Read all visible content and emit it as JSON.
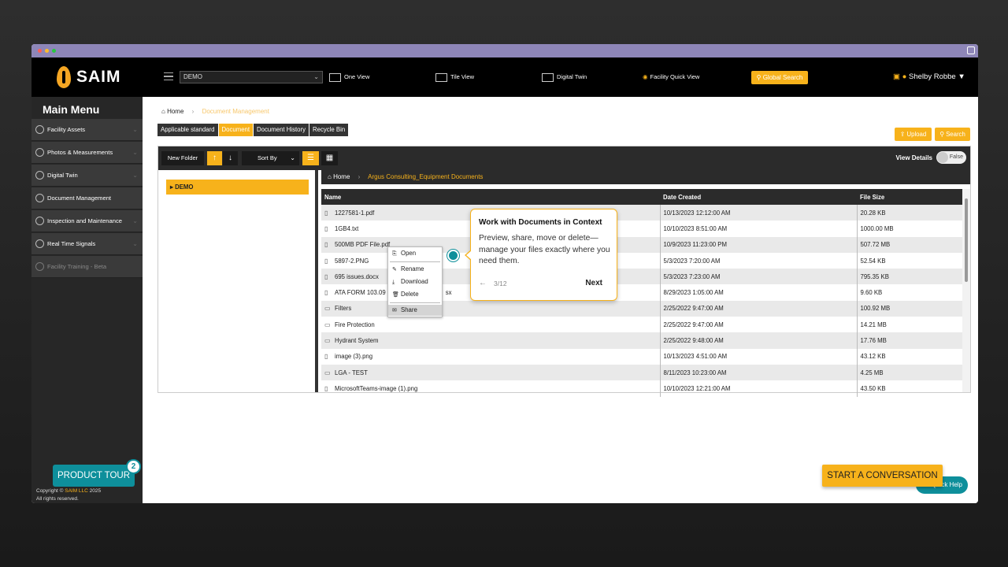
{
  "window": {
    "dot_colors": [
      "#ff5f57",
      "#febc2e",
      "#28c840"
    ]
  },
  "topbar": {
    "logo_text": "SAIM",
    "site_select": "DEMO",
    "nav": {
      "one_view": "One View",
      "tile_view": "Tile View",
      "digital_twin": "Digital Twin",
      "facility_quick_view": "Facility Quick View",
      "global_search": "Global Search"
    },
    "user_name": "Shelby Robbe"
  },
  "sidebar": {
    "title": "Main Menu",
    "items": [
      {
        "label": "Facility Assets"
      },
      {
        "label": "Photos & Measurements"
      },
      {
        "label": "Digital Twin"
      },
      {
        "label": "Document Management"
      },
      {
        "label": "Inspection and Maintenance"
      },
      {
        "label": "Real Time Signals"
      },
      {
        "label": "Facility Training - Beta"
      }
    ],
    "copyright_prefix": "Copyright ©",
    "copyright_org": "SAIM LLC",
    "copyright_year": "2025",
    "rights": "All rights reserved."
  },
  "main": {
    "breadcrumb": {
      "home": "Home",
      "current": "Document Management"
    },
    "tabs": [
      {
        "label": "Applicable standard"
      },
      {
        "label": "Document"
      },
      {
        "label": "Document History"
      },
      {
        "label": "Recycle Bin"
      }
    ],
    "upload_label": "Upload",
    "search_label": "Search",
    "toolbar": {
      "new_folder": "New Folder",
      "sort_by": "Sort By",
      "view_details": "View Details",
      "toggle_value": "False"
    },
    "tree_root": "DEMO",
    "file_breadcrumb": {
      "home": "Home",
      "current": "Argus Consulting_Equipment Documents"
    },
    "columns": {
      "name": "Name",
      "date": "Date Created",
      "size": "File Size"
    },
    "rows": [
      {
        "name": "1227581-1.pdf",
        "date": "10/13/2023 12:12:00 AM",
        "size": "20.28 KB"
      },
      {
        "name": "1GB4.txt",
        "date": "10/10/2023 8:51:00 AM",
        "size": "1000.00 MB"
      },
      {
        "name": "500MB PDF File.pdf",
        "date": "10/9/2023 11:23:00 PM",
        "size": "507.72 MB"
      },
      {
        "name": "5897-2.PNG",
        "date": "5/3/2023 7:20:00 AM",
        "size": "52.54 KB"
      },
      {
        "name": "695 issues.docx",
        "date": "5/3/2023 7:23:00 AM",
        "size": "795.35 KB"
      },
      {
        "name": "ATA FORM 103.09",
        "name_tail": "sx",
        "date": "8/29/2023 1:05:00 AM",
        "size": "9.60 KB"
      },
      {
        "name": "Filters",
        "date": "2/25/2022 9:47:00 AM",
        "size": "100.92 MB"
      },
      {
        "name": "Fire Protection",
        "date": "2/25/2022 9:47:00 AM",
        "size": "14.21 MB"
      },
      {
        "name": "Hydrant System",
        "date": "2/25/2022 9:48:00 AM",
        "size": "17.76 MB"
      },
      {
        "name": "image (3).png",
        "date": "10/13/2023 4:51:00 AM",
        "size": "43.12 KB"
      },
      {
        "name": "LGA - TEST",
        "date": "8/11/2023 10:23:00 AM",
        "size": "4.25 MB"
      },
      {
        "name": "MicrosoftTeams-image (1).png",
        "date": "10/10/2023 12:21:00 AM",
        "size": "43.50 KB"
      }
    ],
    "context_menu": {
      "open": "Open",
      "rename": "Rename",
      "download": "Download",
      "delete": "Delete",
      "share": "Share"
    }
  },
  "tour_popup": {
    "title": "Work with Documents in Context",
    "body": "Preview, share, move or delete—manage your files exactly where you need them.",
    "back": "←",
    "step": "3/12",
    "next": "Next"
  },
  "product_tour": {
    "label": "PRODUCT TOUR",
    "badge": "2"
  },
  "quick_help": "Quick Help",
  "start_conversation": "START A CONVERSATION"
}
